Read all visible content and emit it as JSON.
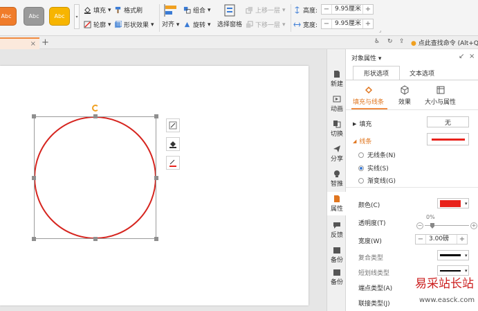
{
  "ribbon": {
    "styles": [
      {
        "label": "Abc",
        "color": "#f07c2a"
      },
      {
        "label": "Abc",
        "color": "#9a9a9a"
      },
      {
        "label": "Abc",
        "color": "#f7b500"
      }
    ],
    "fill_label": "填充",
    "format_brush_label": "格式刷",
    "outline_label": "轮廓",
    "shape_effect_label": "形状效果",
    "align_label": "对齐",
    "group_label": "组合",
    "rotate_label": "旋转",
    "select_pane_label": "选择窗格",
    "bring_forward_label": "上移一层",
    "send_backward_label": "下移一层",
    "height_label": "高度:",
    "height_value": "9.95厘米",
    "width_label": "宽度:",
    "width_value": "9.95厘米",
    "minus": "−",
    "plus": "+"
  },
  "tabrow": {
    "close": "×",
    "new_tab": "+",
    "find_command": "点此查找命令 (Alt+Q)"
  },
  "rail": [
    {
      "label": "新建",
      "icon": "new-file-icon"
    },
    {
      "label": "动画",
      "icon": "animation-icon"
    },
    {
      "label": "切换",
      "icon": "transition-icon"
    },
    {
      "label": "分享",
      "icon": "share-icon"
    },
    {
      "label": "智推",
      "icon": "smart-recommend-icon"
    },
    {
      "label": "属性",
      "icon": "property-icon",
      "active": true
    },
    {
      "label": "反馈",
      "icon": "feedback-icon"
    },
    {
      "label": "备份",
      "icon": "backup-icon"
    },
    {
      "label": "备份",
      "icon": "backup-icon"
    }
  ],
  "panel": {
    "title": "对象属性 ▾",
    "tab_shape": "形状选项",
    "tab_text": "文本选项",
    "sub_fill_line": "填充与线条",
    "sub_effect": "效果",
    "sub_size": "大小与属性",
    "fill_label": "填充",
    "fill_value": "无",
    "line_label": "线条",
    "no_line": "无线条(N)",
    "solid_line": "实线(S)",
    "gradient_line": "渐变线(G)",
    "color_label": "颜色(C)",
    "transparency_label": "透明度(T)",
    "transparency_value": "0%",
    "width_label": "宽度(W)",
    "width_value": "3.00磅",
    "compound_label": "复合类型",
    "dash_label": "短划线类型",
    "cap_label": "端点类型(A)",
    "join_label": "联接类型(J)",
    "line_color": "#e8221b"
  },
  "watermark": {
    "text": "易采站长站",
    "url": "www.easck.com"
  }
}
